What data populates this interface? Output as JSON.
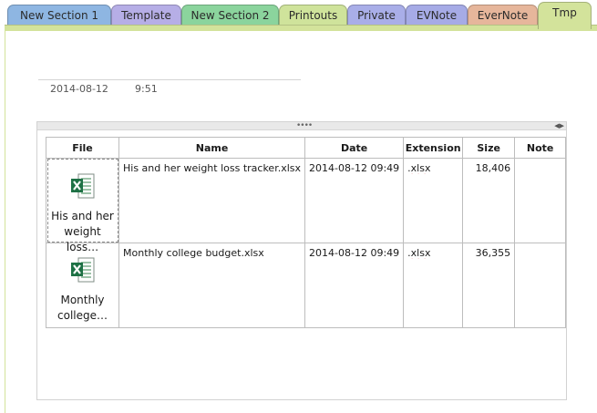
{
  "tabs": [
    {
      "label": "New Section 1",
      "color": "#8eb6e2"
    },
    {
      "label": "Template",
      "color": "#b6aee6"
    },
    {
      "label": "New Section 2",
      "color": "#8bd49d"
    },
    {
      "label": "Printouts",
      "color": "#cfe39b"
    },
    {
      "label": "Private",
      "color": "#a9aee8"
    },
    {
      "label": "EVNote",
      "color": "#a6abe6"
    },
    {
      "label": "EverNote",
      "color": "#e6b69b"
    },
    {
      "label": "Tmp",
      "color": "#d3e39b",
      "active": true
    }
  ],
  "page": {
    "date": "2014-08-12",
    "time": "9:51"
  },
  "table": {
    "headers": {
      "file": "File",
      "name": "Name",
      "date": "Date",
      "extension": "Extension",
      "size": "Size",
      "note": "Note"
    },
    "rows": [
      {
        "file_caption": "His and her weight loss…",
        "name": "His and her weight loss tracker.xlsx",
        "date": "2014-08-12 09:49",
        "extension": ".xlsx",
        "size": "18,406",
        "note": "",
        "icon": "excel-file-icon",
        "selected": true
      },
      {
        "file_caption": "Monthly college…",
        "name": "Monthly college budget.xlsx",
        "date": "2014-08-12 09:49",
        "extension": ".xlsx",
        "size": "36,355",
        "note": "",
        "icon": "excel-file-icon",
        "selected": false
      }
    ]
  },
  "colors": {
    "active_section": "#d3e39b",
    "excel_green": "#1e7145"
  }
}
